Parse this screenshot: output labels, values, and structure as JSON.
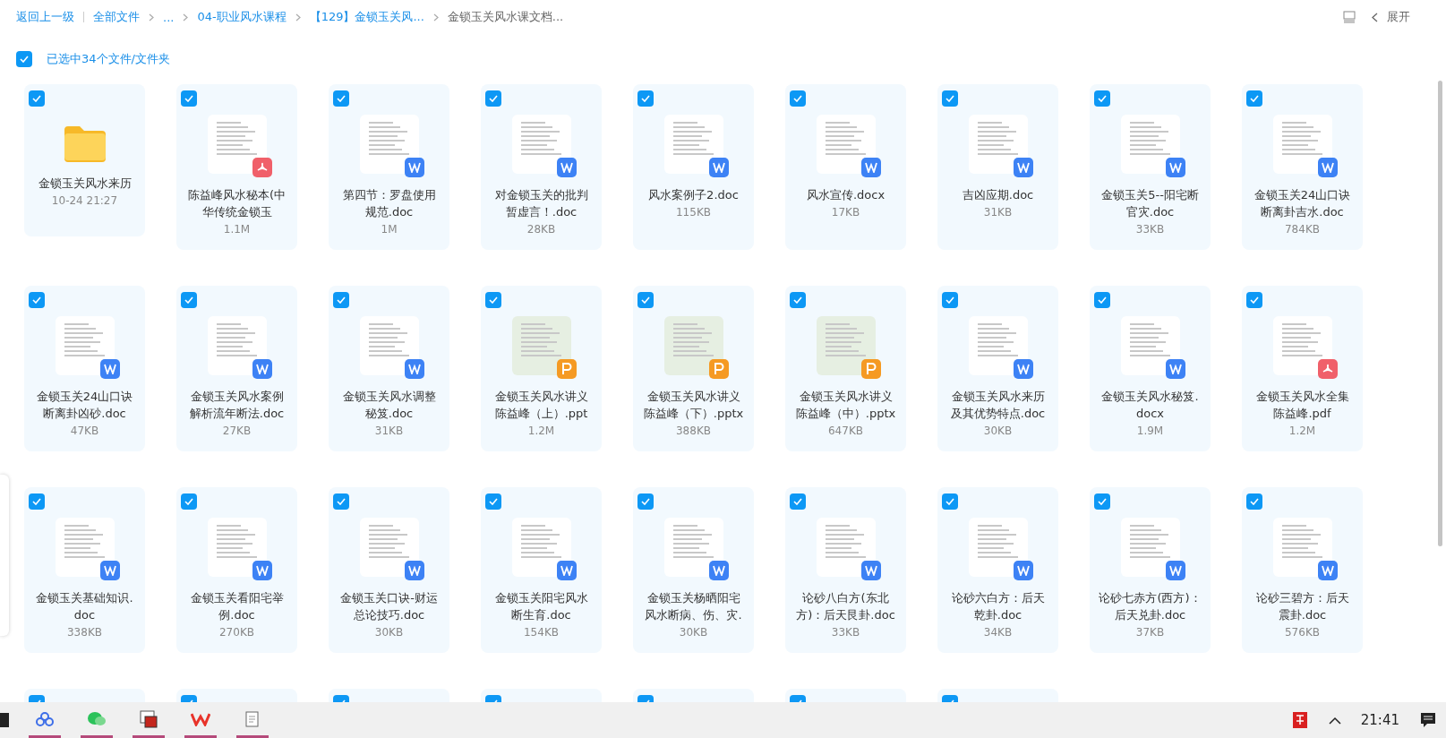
{
  "breadcrumb": {
    "back": "返回上一级",
    "items": [
      {
        "label": "全部文件",
        "current": false
      },
      {
        "label": "...",
        "current": false
      },
      {
        "label": "04-职业风水课程",
        "current": false
      },
      {
        "label": "【129】金锁玉关风...",
        "current": false
      },
      {
        "label": "金锁玉关风水课文档...",
        "current": true
      }
    ],
    "expand": "展开"
  },
  "selection": {
    "checked": true,
    "label": "已选中34个文件/文件夹"
  },
  "files": [
    {
      "name": "金锁玉关风水来历",
      "meta": "10-24 21:27",
      "kind": "folder",
      "checked": true
    },
    {
      "name": "陈益峰风水秘本(中华传统金锁玉",
      "meta": "1.1M",
      "kind": "pdf",
      "checked": true
    },
    {
      "name": "第四节：罗盘使用规范.doc",
      "meta": "1M",
      "kind": "word",
      "checked": true
    },
    {
      "name": "对金锁玉关的批判暂虚言！.doc",
      "meta": "28KB",
      "kind": "word",
      "checked": true
    },
    {
      "name": "风水案例子2.doc",
      "meta": "115KB",
      "kind": "word",
      "checked": true
    },
    {
      "name": "风水宣传.docx",
      "meta": "17KB",
      "kind": "word",
      "checked": true
    },
    {
      "name": "吉凶应期.doc",
      "meta": "31KB",
      "kind": "word",
      "checked": true
    },
    {
      "name": "金锁玉关5--阳宅断官灾.doc",
      "meta": "33KB",
      "kind": "word",
      "checked": true
    },
    {
      "name": "金锁玉关24山口诀断离卦吉水.doc",
      "meta": "784KB",
      "kind": "word",
      "checked": true
    },
    {
      "name": "金锁玉关24山口诀断离卦凶砂.doc",
      "meta": "47KB",
      "kind": "word",
      "checked": true
    },
    {
      "name": "金锁玉关风水案例解析流年断法.doc",
      "meta": "27KB",
      "kind": "word",
      "checked": true
    },
    {
      "name": "金锁玉关风水调整秘笈.doc",
      "meta": "31KB",
      "kind": "word",
      "checked": true
    },
    {
      "name": "金锁玉关风水讲义陈益峰（上）.ppt",
      "meta": "1.2M",
      "kind": "ppt",
      "checked": true
    },
    {
      "name": "金锁玉关风水讲义陈益峰（下）.pptx",
      "meta": "388KB",
      "kind": "ppt",
      "checked": true
    },
    {
      "name": "金锁玉关风水讲义陈益峰（中）.pptx",
      "meta": "647KB",
      "kind": "ppt",
      "checked": true
    },
    {
      "name": "金锁玉关风水来历及其优势特点.doc",
      "meta": "30KB",
      "kind": "word",
      "checked": true
    },
    {
      "name": "金锁玉关风水秘笈.docx",
      "meta": "1.9M",
      "kind": "word",
      "checked": true
    },
    {
      "name": "金锁玉关风水全集陈益峰.pdf",
      "meta": "1.2M",
      "kind": "pdf",
      "checked": true
    },
    {
      "name": "金锁玉关基础知识.doc",
      "meta": "338KB",
      "kind": "word",
      "checked": true
    },
    {
      "name": "金锁玉关看阳宅举例.doc",
      "meta": "270KB",
      "kind": "word",
      "checked": true
    },
    {
      "name": "金锁玉关口诀-财运总论技巧.doc",
      "meta": "30KB",
      "kind": "word",
      "checked": true
    },
    {
      "name": "金锁玉关阳宅风水断生育.doc",
      "meta": "154KB",
      "kind": "word",
      "checked": true
    },
    {
      "name": "金锁玉关杨晒阳宅风水断病、伤、灾.",
      "meta": "30KB",
      "kind": "word",
      "checked": true
    },
    {
      "name": "论砂八白方(东北方)：后天艮卦.doc",
      "meta": "33KB",
      "kind": "word",
      "checked": true
    },
    {
      "name": "论砂六白方：后天乾卦.doc",
      "meta": "34KB",
      "kind": "word",
      "checked": true
    },
    {
      "name": "论砂七赤方(西方)：后天兑卦.doc",
      "meta": "37KB",
      "kind": "word",
      "checked": true
    },
    {
      "name": "论砂三碧方：后天震卦.doc",
      "meta": "576KB",
      "kind": "word",
      "checked": true
    }
  ],
  "more_files": [
    {
      "checked": true
    },
    {
      "checked": true
    },
    {
      "checked": true
    },
    {
      "checked": true
    },
    {
      "checked": true
    },
    {
      "checked": true
    },
    {
      "checked": true
    }
  ],
  "taskbar": {
    "time": "21:41"
  }
}
